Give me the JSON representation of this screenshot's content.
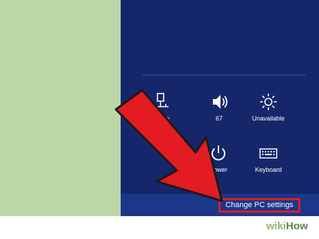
{
  "charms": {
    "quick_settings": [
      {
        "icon": "network-icon",
        "label": "Netw"
      },
      {
        "icon": "volume-icon",
        "label": "67"
      },
      {
        "icon": "brightness-icon",
        "label": "Unavailable"
      },
      {
        "icon": "notifications-icon",
        "label": ""
      },
      {
        "icon": "power-icon",
        "label": "Power"
      },
      {
        "icon": "keyboard-icon",
        "label": "Keyboard"
      }
    ],
    "change_pc_settings": "Change PC settings"
  },
  "annotation": {
    "arrow_color": "#e31b23",
    "highlight_color": "#e31b23"
  },
  "watermark": {
    "part1": "wiki",
    "part2": "How"
  }
}
